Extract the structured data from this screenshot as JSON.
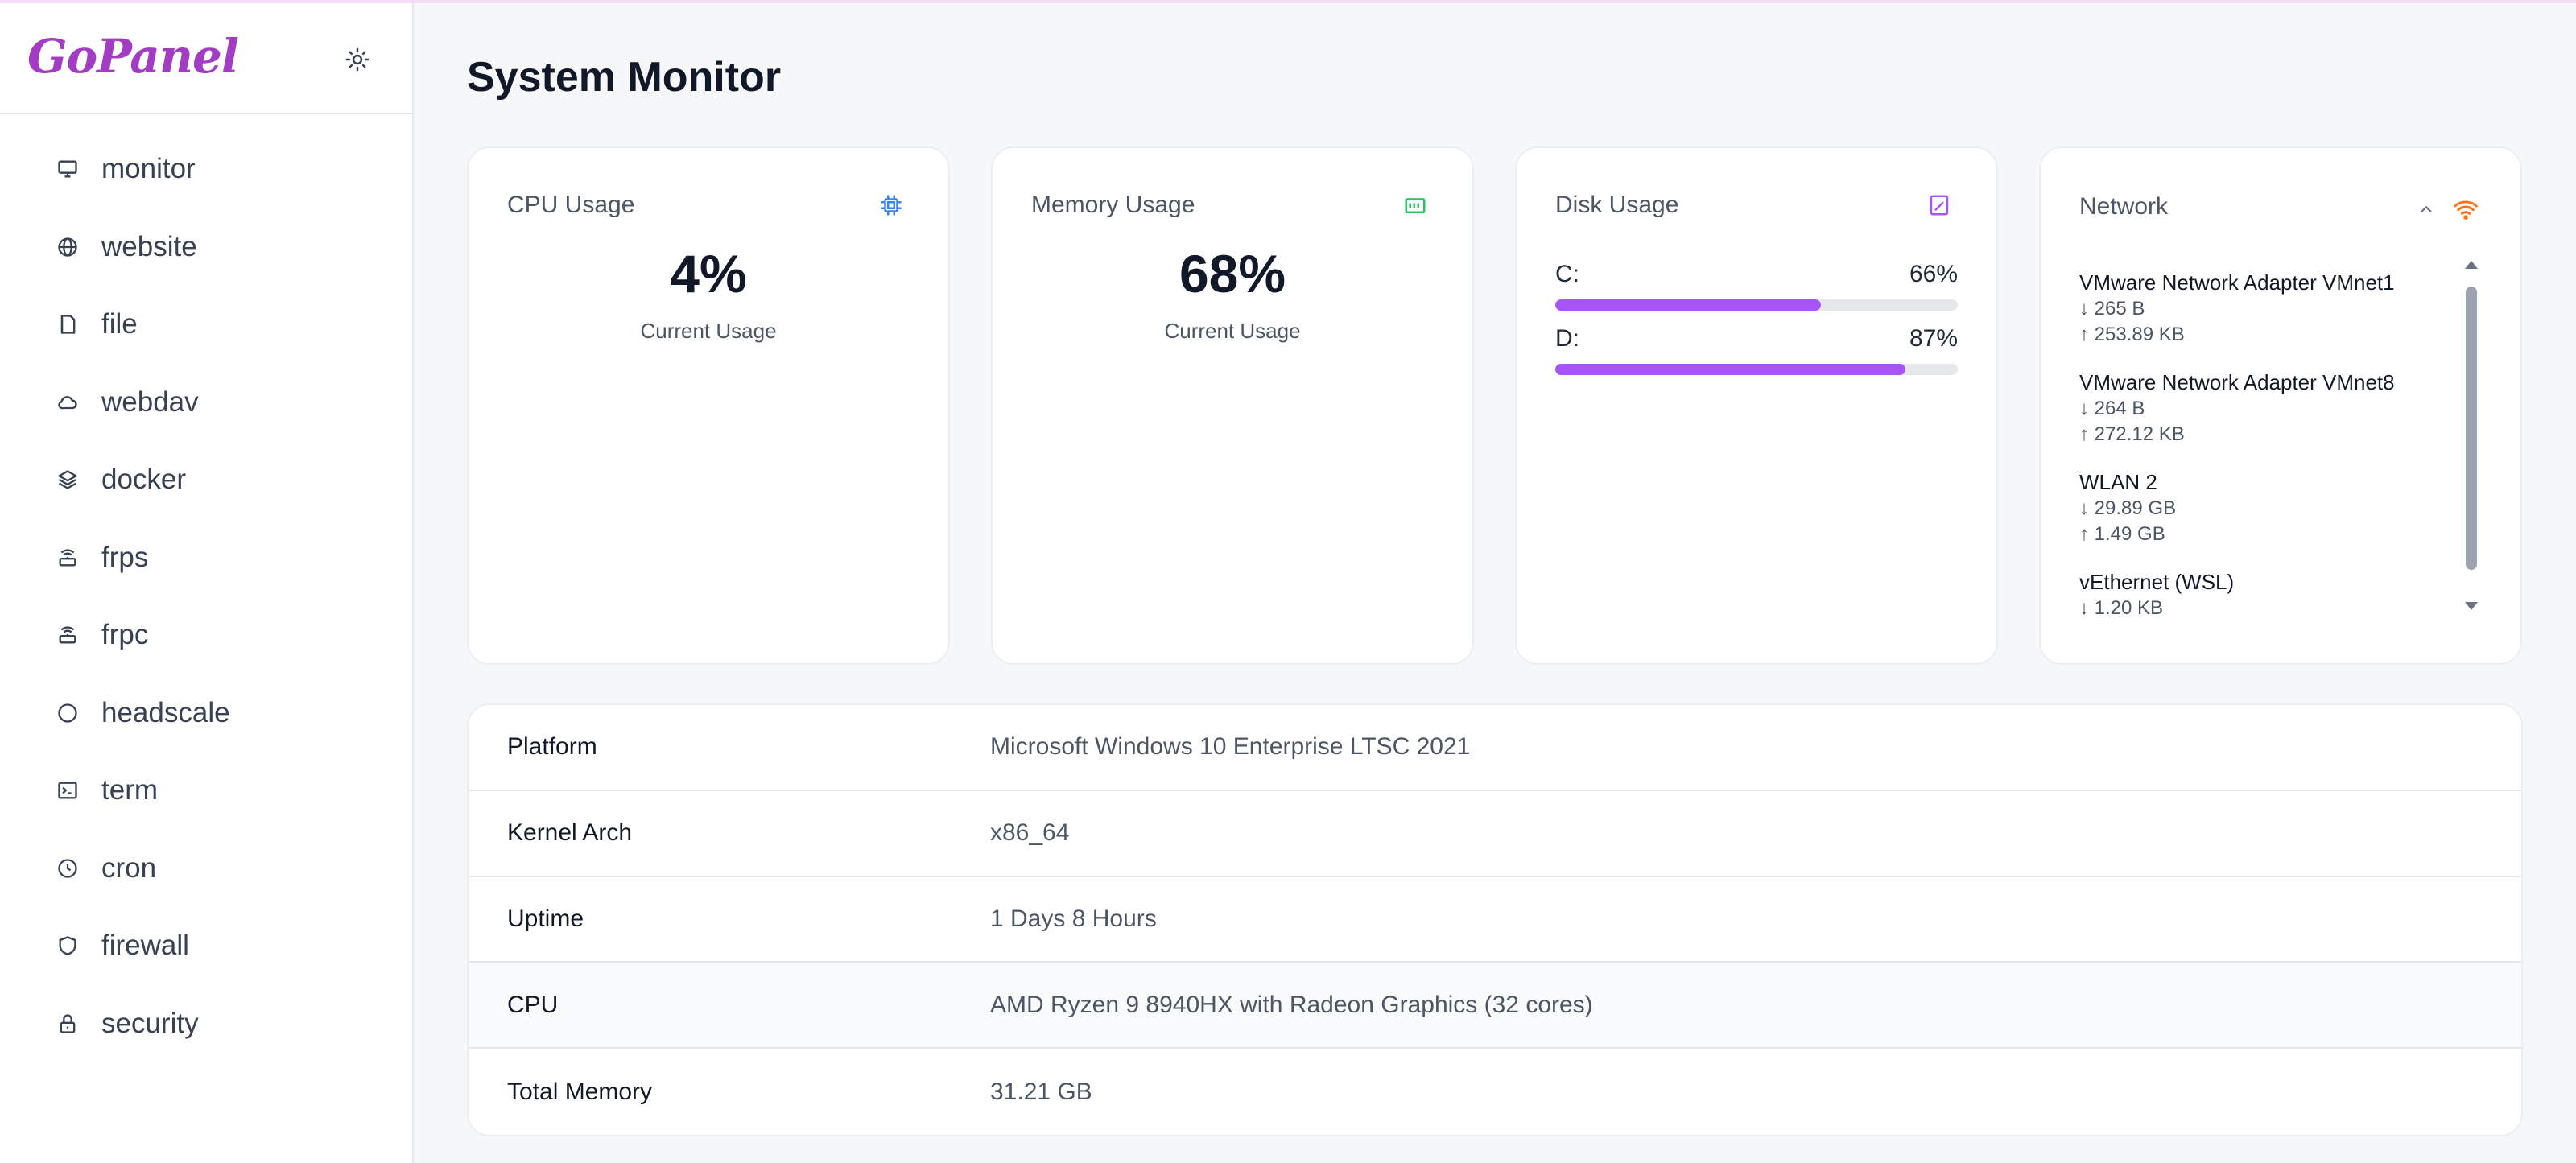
{
  "brand": {
    "logo": "GoPanel"
  },
  "sidebar": {
    "items": [
      {
        "label": "monitor",
        "icon": "monitor-icon"
      },
      {
        "label": "website",
        "icon": "globe-icon"
      },
      {
        "label": "file",
        "icon": "file-icon"
      },
      {
        "label": "webdav",
        "icon": "cloud-icon"
      },
      {
        "label": "docker",
        "icon": "layers-icon"
      },
      {
        "label": "frps",
        "icon": "router-icon"
      },
      {
        "label": "frpc",
        "icon": "router-icon"
      },
      {
        "label": "headscale",
        "icon": "circle-icon"
      },
      {
        "label": "term",
        "icon": "terminal-icon"
      },
      {
        "label": "cron",
        "icon": "clock-icon"
      },
      {
        "label": "firewall",
        "icon": "shield-icon"
      },
      {
        "label": "security",
        "icon": "lock-icon"
      }
    ]
  },
  "main": {
    "title": "System Monitor"
  },
  "cpu": {
    "title": "CPU Usage",
    "value": "4%",
    "caption": "Current Usage",
    "icon": "cpu-icon",
    "color": "#3b82f6"
  },
  "memory": {
    "title": "Memory Usage",
    "value": "68%",
    "caption": "Current Usage",
    "icon": "memory-icon",
    "color": "#22c55e"
  },
  "disk": {
    "title": "Disk Usage",
    "icon": "disk-icon",
    "color": "#a855f7",
    "drives": [
      {
        "name": "C:",
        "percent_label": "66%",
        "percent": 66
      },
      {
        "name": "D:",
        "percent_label": "87%",
        "percent": 87
      }
    ]
  },
  "network": {
    "title": "Network",
    "icon": "wifi-icon",
    "color": "#f97316",
    "adapters": [
      {
        "name": "VMware Network Adapter VMnet1",
        "rx": "↓ 265 B",
        "tx": "↑ 253.89 KB"
      },
      {
        "name": "VMware Network Adapter VMnet8",
        "rx": "↓ 264 B",
        "tx": "↑ 272.12 KB"
      },
      {
        "name": "WLAN 2",
        "rx": "↓ 29.89 GB",
        "tx": "↑ 1.49 GB"
      },
      {
        "name": "vEthernet (WSL)",
        "rx": "↓ 1.20 KB",
        "tx": ""
      }
    ]
  },
  "info": {
    "rows": [
      {
        "key": "Platform",
        "value": "Microsoft Windows 10 Enterprise LTSC 2021"
      },
      {
        "key": "Kernel Arch",
        "value": "x86_64"
      },
      {
        "key": "Uptime",
        "value": "1 Days 8 Hours"
      },
      {
        "key": "CPU",
        "value": "AMD Ryzen 9 8940HX with Radeon Graphics (32 cores)"
      },
      {
        "key": "Total Memory",
        "value": "31.21 GB"
      }
    ]
  }
}
